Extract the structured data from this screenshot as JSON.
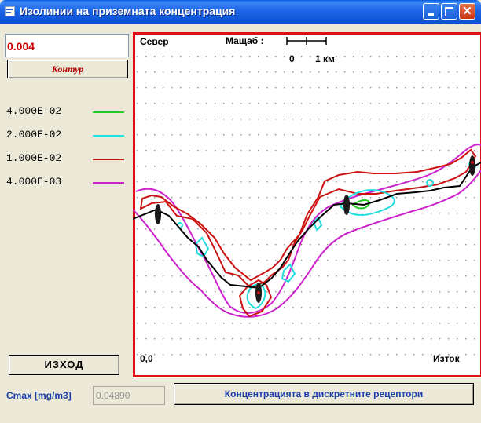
{
  "window": {
    "title": "Изолинии на приземната концентрация",
    "close_glyph": "✕"
  },
  "left_panel": {
    "value": "0.004",
    "contour_button": "Контур",
    "legend": [
      {
        "label": "4.000E-02",
        "color": "#22cc22"
      },
      {
        "label": "2.000E-02",
        "color": "#22dddd"
      },
      {
        "label": "1.000E-02",
        "color": "#cc1111"
      },
      {
        "label": "4.000E-03",
        "color": "#cc22cc"
      }
    ],
    "exit_button": "ИЗХОД"
  },
  "plot": {
    "north_label": "Север",
    "scale_label": "Мащаб :",
    "scale_zero": "0",
    "scale_km": "1 км",
    "origin_label": "0,0",
    "east_label": "Изток",
    "frame_color": "#dd1111"
  },
  "bottom": {
    "cmax_label": "Cmax [mg/m3]",
    "cmax_value": "0.04890",
    "receptors_button": "Концентрацията в дискретните рецептори"
  }
}
